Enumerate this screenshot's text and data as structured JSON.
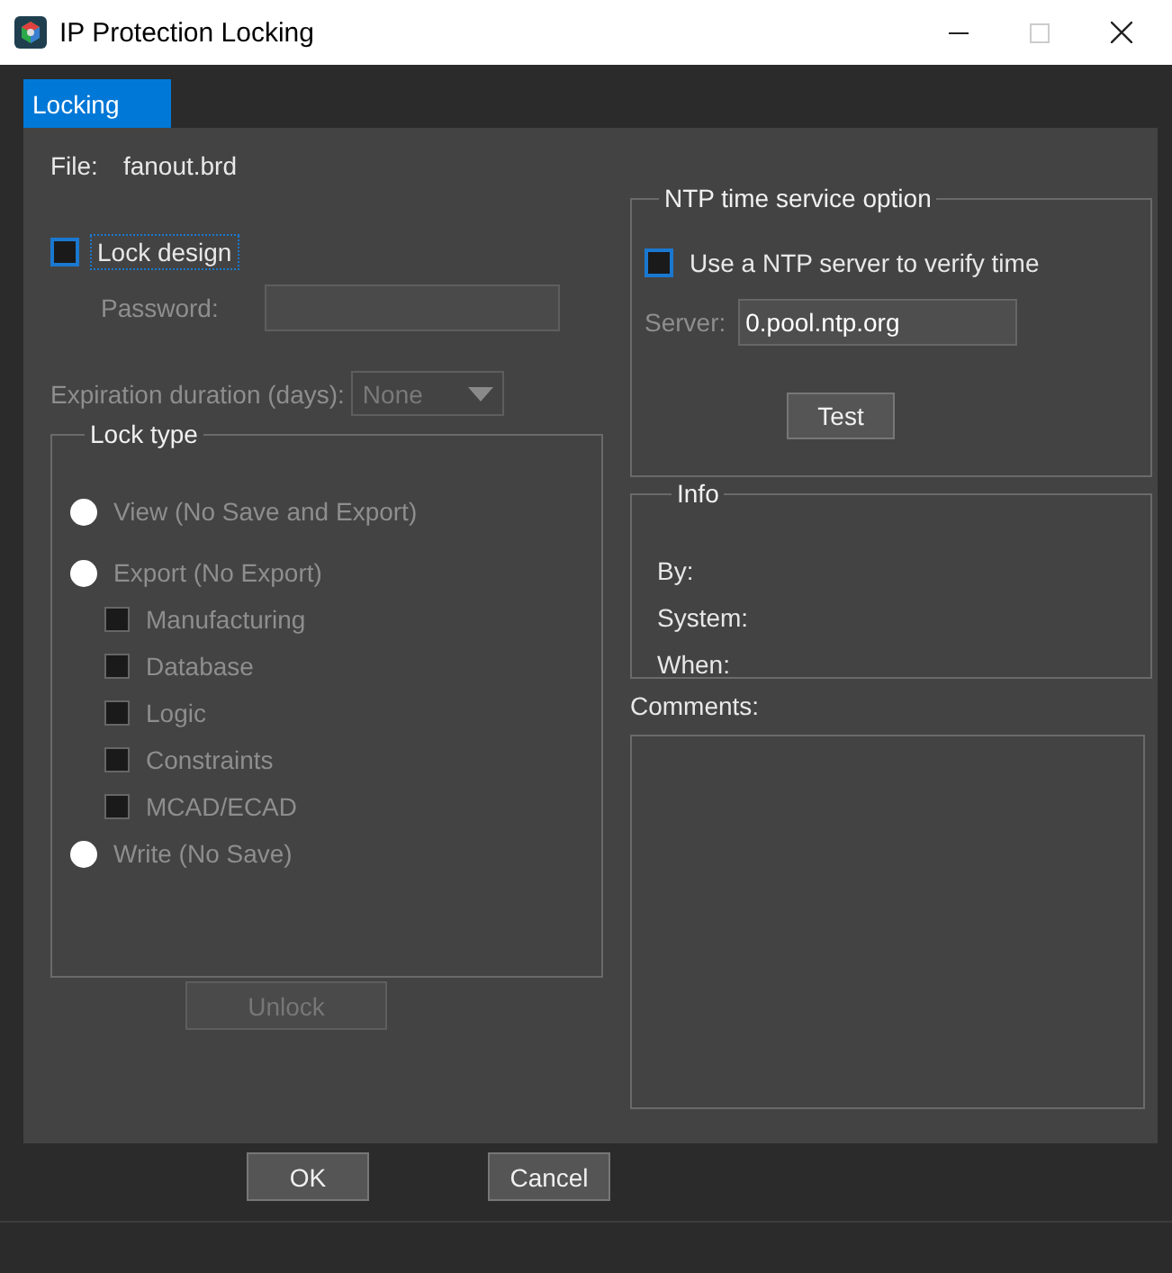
{
  "window": {
    "title": "IP Protection Locking"
  },
  "tabs": [
    {
      "label": "Locking",
      "selected": true
    }
  ],
  "file": {
    "label": "File:",
    "value": "fanout.brd"
  },
  "lock_design": {
    "label": "Lock design",
    "checked": false,
    "focused": true
  },
  "password": {
    "label": "Password:",
    "disabled": true
  },
  "expiration": {
    "label": "Expiration duration (days):",
    "value": "None",
    "disabled": true
  },
  "lock_type": {
    "title": "Lock type",
    "items": [
      {
        "kind": "radio",
        "label": "View (No Save and Export)",
        "selected": false,
        "disabled": true
      },
      {
        "kind": "radio",
        "label": "Export (No Export)",
        "selected": false,
        "disabled": true
      },
      {
        "kind": "checkbox",
        "label": "Manufacturing",
        "checked": false,
        "disabled": true
      },
      {
        "kind": "checkbox",
        "label": "Database",
        "checked": false,
        "disabled": true
      },
      {
        "kind": "checkbox",
        "label": "Logic",
        "checked": false,
        "disabled": true
      },
      {
        "kind": "checkbox",
        "label": "Constraints",
        "checked": false,
        "disabled": true
      },
      {
        "kind": "checkbox",
        "label": "MCAD/ECAD",
        "checked": false,
        "disabled": true
      },
      {
        "kind": "radio",
        "label": "Write (No Save)",
        "selected": false,
        "disabled": true
      }
    ]
  },
  "unlock_button": {
    "label": "Unlock",
    "disabled": true
  },
  "ntp": {
    "title": "NTP time service option",
    "use_ntp": {
      "label": "Use a NTP server to verify time",
      "checked": false
    },
    "server": {
      "label": "Server:",
      "value": "0.pool.ntp.org"
    },
    "test_button": "Test"
  },
  "info": {
    "title": "Info",
    "fields": [
      "By:",
      "System:",
      "When:"
    ]
  },
  "comments": {
    "label": "Comments:"
  },
  "buttons": [
    "OK",
    "Cancel"
  ]
}
